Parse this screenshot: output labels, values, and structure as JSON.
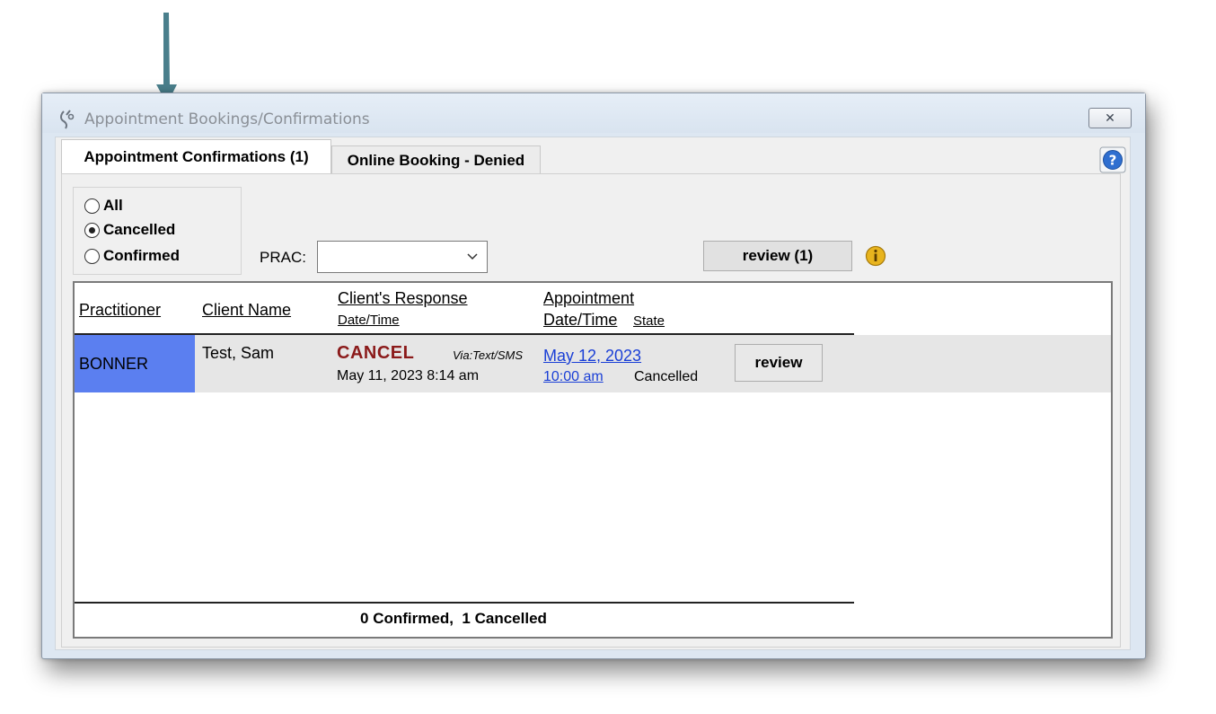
{
  "window": {
    "title": "Appointment Bookings/Confirmations",
    "close_glyph": "✕"
  },
  "tabs": [
    {
      "label": "Appointment Confirmations (1)",
      "active": true
    },
    {
      "label": "Online Booking - Denied",
      "active": false
    }
  ],
  "filters": {
    "options": [
      {
        "label": "All",
        "checked": false
      },
      {
        "label": "Cancelled",
        "checked": true
      },
      {
        "label": "Confirmed",
        "checked": false
      }
    ]
  },
  "prac": {
    "label": "PRAC:",
    "value": ""
  },
  "review_top": {
    "label": "review (1)"
  },
  "grid": {
    "headers": {
      "practitioner": "Practitioner",
      "client_name": "Client Name",
      "client_response": "Client's Response",
      "client_response_sub": "Date/Time",
      "appointment": "Appointment",
      "appointment_sub": "Date/Time",
      "state": "State"
    },
    "rows": [
      {
        "practitioner": "BONNER",
        "client": "Test, Sam",
        "response": "CANCEL",
        "via": "Via:Text/SMS",
        "response_time": "May 11, 2023 8:14 am",
        "appt_date": "May 12, 2023",
        "appt_time": "10:00 am",
        "state": "Cancelled",
        "action": "review"
      }
    ],
    "summary": {
      "confirmed_count": "0",
      "confirmed_label": "Confirmed,",
      "cancelled_count": "1",
      "cancelled_label": "Cancelled"
    }
  },
  "colors": {
    "practitioner_highlight": "#5b7ff0",
    "cancel_text": "#8b1a1a",
    "link": "#1a3fd6",
    "arrow": "#4a7f8c"
  },
  "icons": {
    "app": "stethoscope-icon",
    "help": "help-icon",
    "info": "info-icon",
    "dropdown": "chevron-down-icon",
    "annotation": "arrow-down-icon"
  }
}
